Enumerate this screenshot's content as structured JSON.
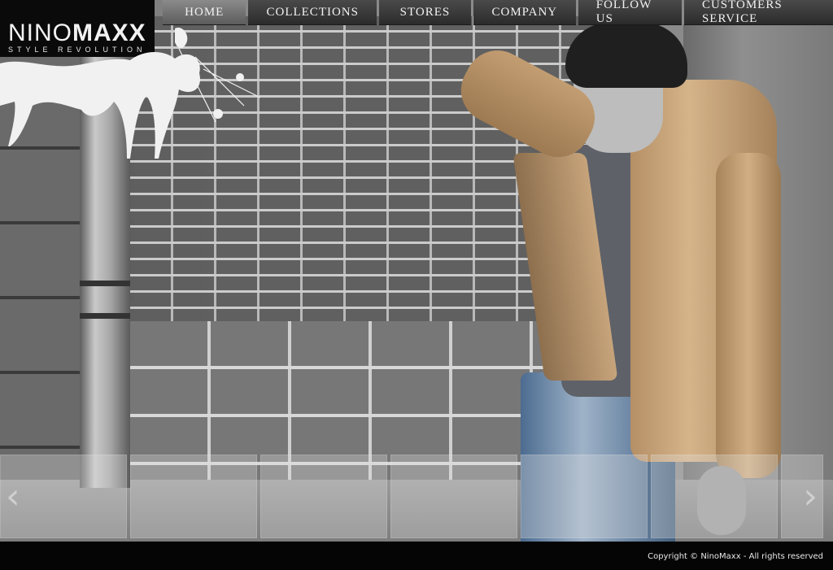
{
  "brand": {
    "name_light": "NINO",
    "name_bold": "MAXX",
    "tagline": "STYLE REVOLUTION"
  },
  "nav": {
    "items": [
      {
        "label": "HOME",
        "active": true
      },
      {
        "label": "COLLECTIONS",
        "active": false
      },
      {
        "label": "STORES",
        "active": false
      },
      {
        "label": "COMPANY",
        "active": false
      },
      {
        "label": "FOLLOW US",
        "active": false
      },
      {
        "label": "CUSTOMERS SERVICE",
        "active": false
      }
    ]
  },
  "carousel": {
    "prev_icon": "chevron-left-icon",
    "next_icon": "chevron-right-icon",
    "thumbnail_count": 6
  },
  "footer": {
    "copyright": "Copyright © NinoMaxx - All rights reserved"
  },
  "colors": {
    "nav_bg": "#333333",
    "nav_active_bg": "#707070",
    "footer_bg": "#050505"
  }
}
